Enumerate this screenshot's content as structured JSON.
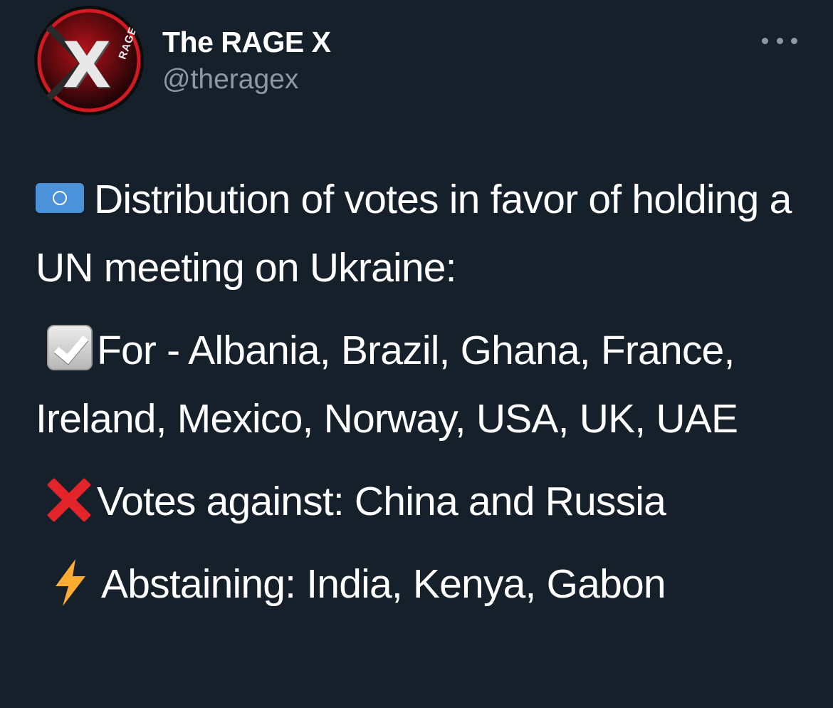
{
  "author": {
    "display_name": "The RAGE X",
    "handle": "@theragex",
    "avatar_letter": "X",
    "avatar_small_text": "RAGE"
  },
  "tweet": {
    "intro": "Distribution of votes in favor of holding a UN meeting on Ukraine:",
    "for_line": "For - Albania, Brazil, Ghana, France, Ireland, Mexico, Norway, USA, UK, UAE",
    "against_line": "Votes against: China and Russia",
    "abstain_line": "Abstaining: India, Kenya, Gabon"
  },
  "icons": {
    "intro": "un-flag-icon",
    "for": "check-mark-button-icon",
    "against": "cross-mark-icon",
    "abstain": "lightning-icon",
    "more": "more-options-icon"
  },
  "colors": {
    "background": "#15202b",
    "text": "#ffffff",
    "secondary_text": "#8b98a5",
    "cross": "#e3242b",
    "bolt": "#ffac33"
  }
}
